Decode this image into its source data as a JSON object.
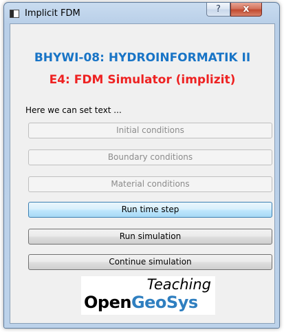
{
  "window": {
    "title": "Implicit FDM",
    "help_label": "?",
    "close_label": "x"
  },
  "header": {
    "line1": "BHYWI-08: HYDROINFORMATIK II",
    "line2": "E4: FDM Simulator (implizit)"
  },
  "info_label": "Here we can set text ...",
  "buttons": [
    {
      "label": "Initial conditions",
      "state": "disabled"
    },
    {
      "label": "Boundary conditions",
      "state": "disabled"
    },
    {
      "label": "Material conditions",
      "state": "disabled"
    },
    {
      "label": "Run time step",
      "state": "focused"
    },
    {
      "label": "Run simulation",
      "state": "enabled"
    },
    {
      "label": "Continue simulation",
      "state": "enabled"
    }
  ],
  "logo": {
    "teaching": "Teaching",
    "open": "Open",
    "geo": "Geo",
    "sys": "Sys"
  },
  "colors": {
    "heading_blue": "#1874c6",
    "heading_red": "#ee2222",
    "logo_blue": "#2f7fc0"
  }
}
